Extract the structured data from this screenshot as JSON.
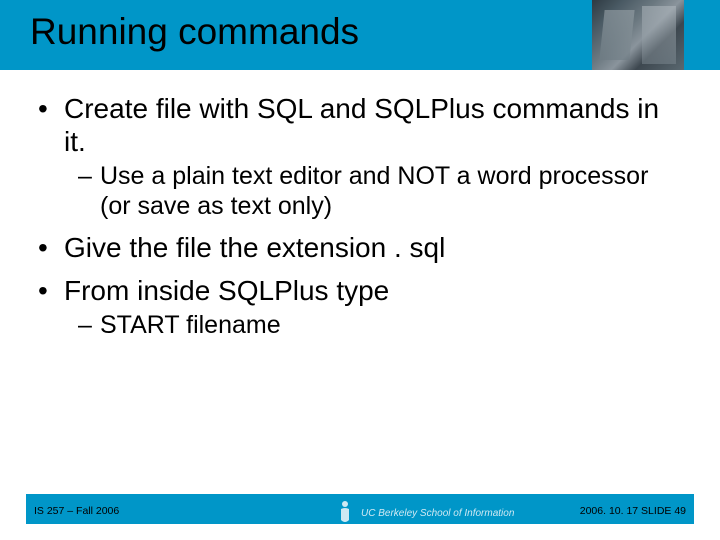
{
  "title": "Running commands",
  "bullets": {
    "b1": "Create file with SQL and SQLPlus commands in it.",
    "b1_sub1": "Use a plain text editor and NOT a word processor (or save as text only)",
    "b2": "Give the file the extension . sql",
    "b3": "From inside SQLPlus type",
    "b3_sub1": "START filename"
  },
  "footer": {
    "left": "IS 257 – Fall 2006",
    "right": "2006. 10. 17 SLIDE 49",
    "logo_text": "UC Berkeley School of Information"
  }
}
